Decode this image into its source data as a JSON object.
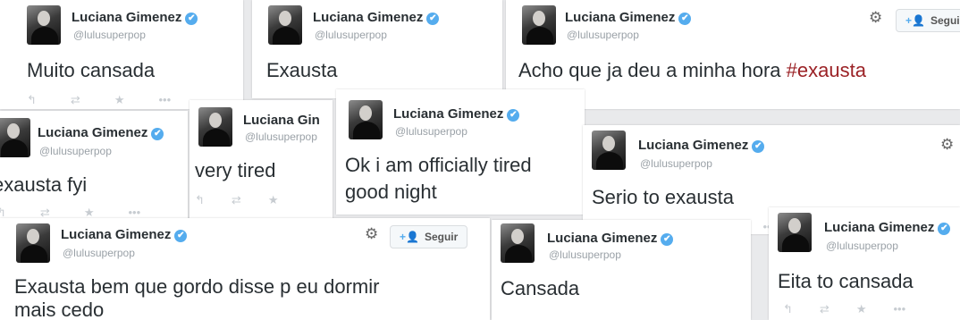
{
  "colors": {
    "background": "#e9eaec",
    "verified": "#55acee",
    "hashtag": "#9b2226",
    "text": "#292f33",
    "handle": "#9aa1a7"
  },
  "icons": {
    "verified": "✔",
    "reply": "↰",
    "retweet": "⇄",
    "favorite": "★",
    "more": "•••",
    "gear": "⚙",
    "follow": "+👤"
  },
  "tweets": [
    {
      "name": "Luciana Gimenez",
      "handle": "@lulusuperpop",
      "text": "Muito cansada"
    },
    {
      "name": "Luciana Gimenez",
      "handle": "@lulusuperpop",
      "text": "Exausta"
    },
    {
      "name": "Luciana Gimenez",
      "handle": "@lulusuperpop",
      "text": "Acho que ja deu a minha hora ",
      "hashtag": "#exausta",
      "follow_label": "Seguir"
    },
    {
      "name": "Luciana Gimenez",
      "handle": "@lulusuperpop",
      "text": "exausta fyi"
    },
    {
      "name": "Luciana Gin",
      "handle": "@lulusuperpop",
      "text": "very tired"
    },
    {
      "name": "Luciana Gimenez",
      "handle": "@lulusuperpop",
      "text_line1": "Ok i am officially tired",
      "text_line2": "good night"
    },
    {
      "name": "Luciana Gimenez",
      "handle": "@lulusuperpop",
      "text": "Serio to  exausta"
    },
    {
      "name": "Luciana Gimenez",
      "handle": "@lulusuperpop",
      "text_line1": "Exausta bem que gordo disse p eu dormir",
      "text_line2": "mais cedo",
      "follow_label": "Seguir"
    },
    {
      "name": "Luciana Gimenez",
      "handle": "@lulusuperpop",
      "text": "Cansada"
    },
    {
      "name": "Luciana Gimenez",
      "handle": "@lulusuperpop",
      "text": "Eita to cansada"
    }
  ]
}
